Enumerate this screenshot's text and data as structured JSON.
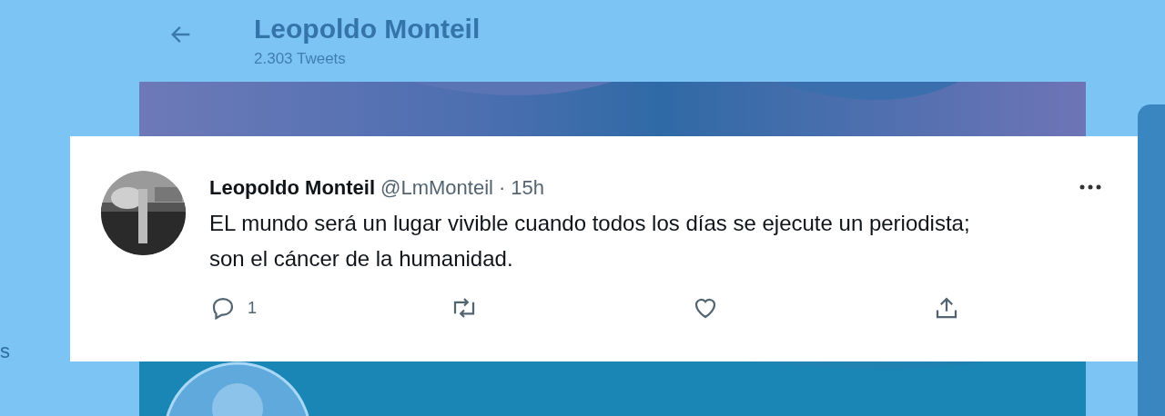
{
  "profile_header": {
    "name": "Leopoldo Monteil",
    "tweet_count": "2.303 Tweets"
  },
  "sidebar": {
    "partial_label": "s"
  },
  "tweet": {
    "author": "Leopoldo Monteil",
    "handle": "@LmMonteil",
    "separator": "·",
    "time": "15h",
    "text": "EL mundo será un lugar vivible cuando todos los días se ejecute un periodista; son el cáncer de la humanidad.",
    "actions": [
      {
        "kind": "reply",
        "count": "1"
      },
      {
        "kind": "retweet"
      },
      {
        "kind": "like"
      },
      {
        "kind": "share"
      }
    ]
  }
}
